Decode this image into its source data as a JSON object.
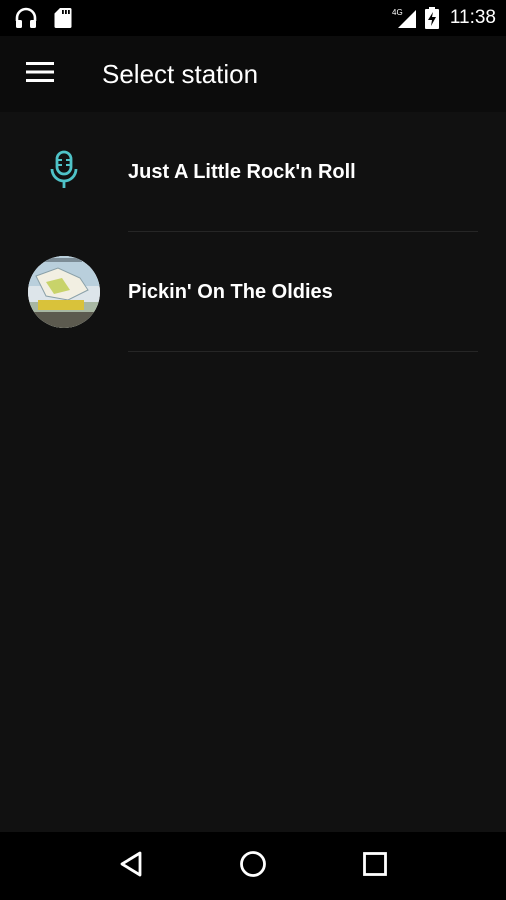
{
  "status_bar": {
    "time": "11:38",
    "network_label": "4G",
    "icons": [
      "headphones-icon",
      "sd-card-icon",
      "signal-icon",
      "battery-charging-icon"
    ]
  },
  "app_bar": {
    "title": "Select station",
    "menu_icon": "hamburger-menu-icon"
  },
  "stations": [
    {
      "name": "Just A Little Rock'n Roll",
      "icon": "microphone-icon"
    },
    {
      "name": "Pickin' On The Oldies",
      "icon": "station-artwork"
    }
  ],
  "nav_bar": {
    "icons": [
      "back-icon",
      "home-icon",
      "recents-icon"
    ]
  },
  "colors": {
    "background": "#111111",
    "status_bar": "#000000",
    "app_bar": "#0c0c0c",
    "accent": "#4fc3c8",
    "divider": "#262626",
    "text": "#ffffff"
  }
}
